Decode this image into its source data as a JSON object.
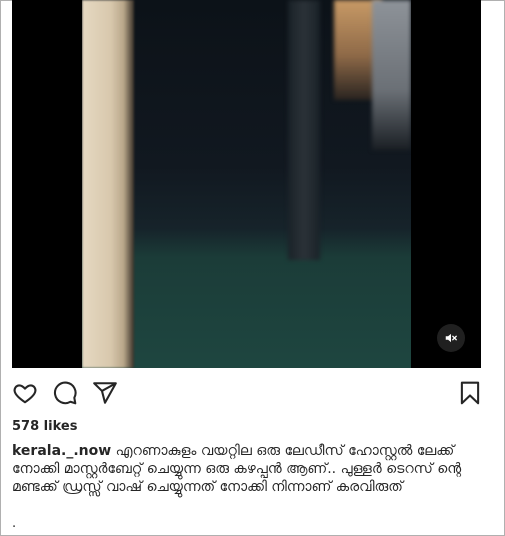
{
  "post": {
    "media": {
      "type": "video",
      "mute_icon": "speaker-muted-icon"
    },
    "actions": {
      "like_icon": "heart-icon",
      "comment_icon": "comment-icon",
      "share_icon": "paper-plane-icon",
      "save_icon": "bookmark-icon"
    },
    "likes_text": "578 likes",
    "caption": {
      "username": "kerala._.now",
      "text": "എറണാകുളം വയറ്റില ഒരു ലേഡീസ് ഹോസ്റ്റൽ ലേക്ക് നോക്കി മാസ്റ്റർബേറ്റ് ചെയ്യുന്ന ഒരു കഴപ്പൻ ആണ്.. പുള്ളർ ടെറസ് ന്റെ മണ്ടക്ക് ഡ്രസ്സ് വാഷ് ചെയ്യുന്നത് നോക്കി നിന്നാണ് കരവിരുത്"
    },
    "trailing_text": "."
  },
  "colors": {
    "text": "#262626",
    "video_bg": "#000000"
  }
}
